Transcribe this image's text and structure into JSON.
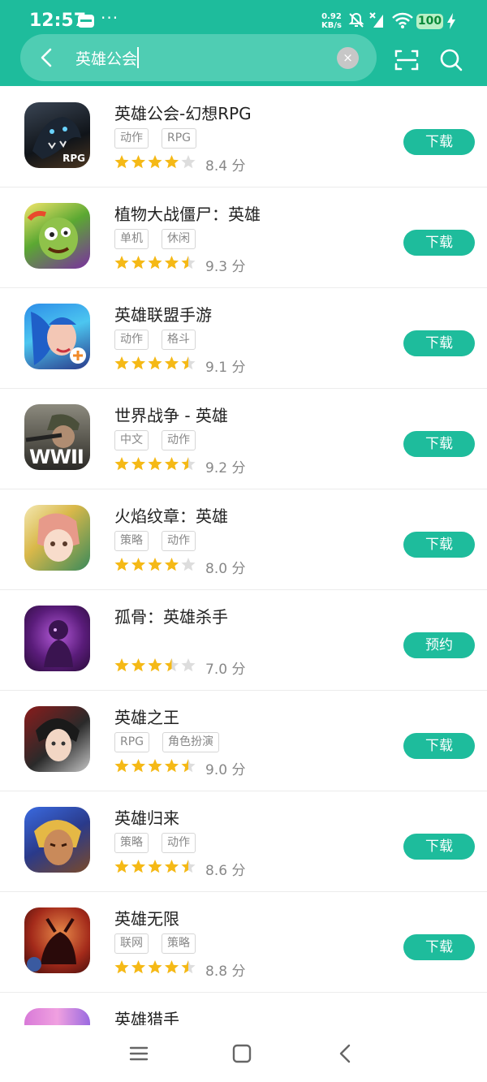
{
  "status_bar": {
    "time": "12:57",
    "more": "···",
    "net_speed_value": "0.92",
    "net_speed_unit": "KB/s",
    "battery": "100"
  },
  "search": {
    "query": "英雄公会",
    "clear": "×"
  },
  "colors": {
    "accent": "#1ebc9c",
    "star": "#f5b916",
    "star_empty": "#dddddd"
  },
  "apps": [
    {
      "title": "英雄公会-幻想RPG",
      "tags": [
        "动作",
        "RPG"
      ],
      "score": "8.4 分",
      "stars": 4,
      "button": "下载",
      "icon_text": "RPG"
    },
    {
      "title": "植物大战僵尸：英雄",
      "tags": [
        "单机",
        "休闲"
      ],
      "score": "9.3 分",
      "stars": 4.5,
      "button": "下载"
    },
    {
      "title": "英雄联盟手游",
      "tags": [
        "动作",
        "格斗"
      ],
      "score": "9.1 分",
      "stars": 4.5,
      "button": "下载"
    },
    {
      "title": "世界战争 - 英雄",
      "tags": [
        "中文",
        "动作"
      ],
      "score": "9.2 分",
      "stars": 4.5,
      "button": "下载",
      "icon_text": "WWII"
    },
    {
      "title": "火焰纹章：英雄",
      "tags": [
        "策略",
        "动作"
      ],
      "score": "8.0 分",
      "stars": 4,
      "button": "下载"
    },
    {
      "title": "孤骨：英雄杀手",
      "tags": [],
      "score": "7.0 分",
      "stars": 3.5,
      "button": "预约"
    },
    {
      "title": "英雄之王",
      "tags": [
        "RPG",
        "角色扮演"
      ],
      "score": "9.0 分",
      "stars": 4.5,
      "button": "下载"
    },
    {
      "title": "英雄归来",
      "tags": [
        "策略",
        "动作"
      ],
      "score": "8.6 分",
      "stars": 4.5,
      "button": "下载"
    },
    {
      "title": "英雄无限",
      "tags": [
        "联网",
        "策略"
      ],
      "score": "8.8 分",
      "stars": 4.5,
      "button": "下载"
    },
    {
      "title": "英雄猎手",
      "tags": [],
      "score": "",
      "stars": 0,
      "button": ""
    }
  ],
  "nav_icons": [
    "menu-icon",
    "home-icon",
    "back-icon"
  ]
}
